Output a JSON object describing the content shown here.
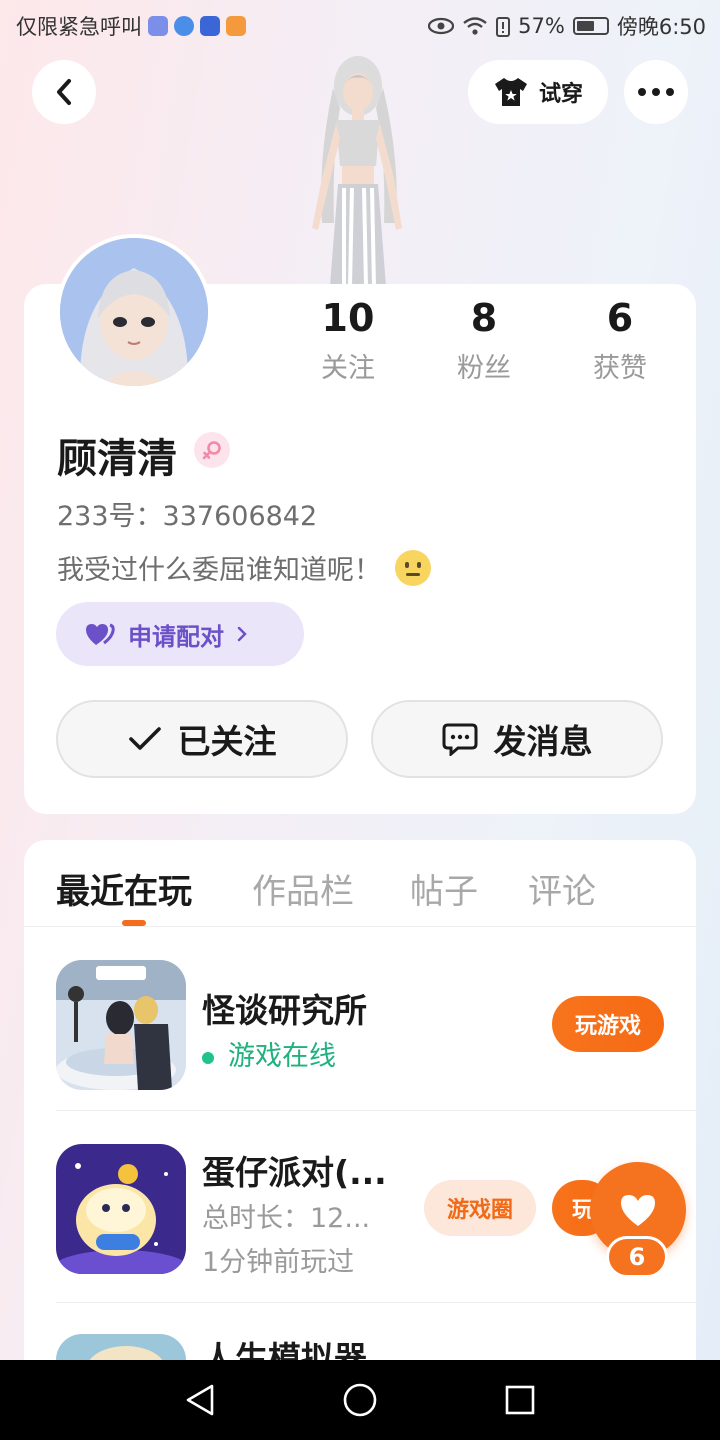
{
  "status_bar": {
    "carrier": "仅限紧急呼叫",
    "battery": "57%",
    "time": "傍晚6:50"
  },
  "header": {
    "try_on_label": "试穿"
  },
  "profile": {
    "name": "顾清清",
    "gender": "female",
    "uid_label": "233号：",
    "uid": "337606842",
    "bio": "我受过什么委屈谁知道呢！",
    "match_label": "申请配对",
    "stats": [
      {
        "value": "10",
        "label": "关注"
      },
      {
        "value": "8",
        "label": "粉丝"
      },
      {
        "value": "6",
        "label": "获赞"
      }
    ],
    "follow_label": "已关注",
    "message_label": "发消息"
  },
  "tabs": [
    "最近在玩",
    "作品栏",
    "帖子",
    "评论"
  ],
  "active_tab": "最近在玩",
  "games": [
    {
      "title": "怪谈研究所",
      "status": "游戏在线",
      "play_label": "玩游戏"
    },
    {
      "title": "蛋仔派对(...",
      "duration": "总时长：12...",
      "last_played": "1分钟前玩过",
      "circle_label": "游戏圈",
      "play_label": "玩"
    },
    {
      "title": "人生模拟器"
    }
  ],
  "like_count": "6",
  "colors": {
    "accent": "#f5731e",
    "online": "#20b27e",
    "match": "#6b50c8"
  }
}
